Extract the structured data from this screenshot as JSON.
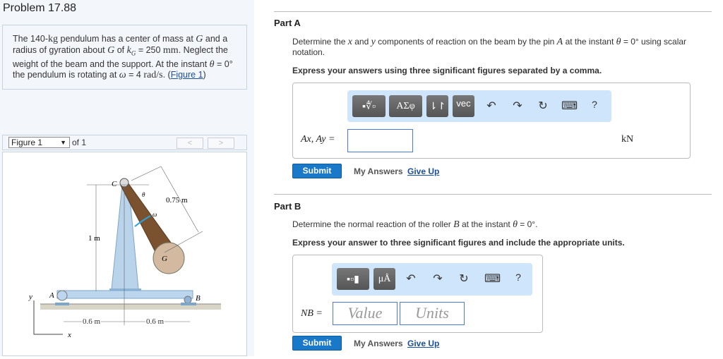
{
  "problem": {
    "title": "Problem 17.88",
    "text_parts": [
      "The 140-",
      "kg",
      " pendulum has a center of mass at ",
      "G",
      " and a radius of gyration about ",
      "G",
      " of ",
      "k",
      "G",
      " = 250 ",
      "mm",
      ". Neglect the weight of the beam and the support. At the instant ",
      "θ",
      " = 0° the pendulum is rotating at ",
      "ω",
      " = 4 ",
      "rad/s",
      ". (",
      ")"
    ],
    "figure_link": "Figure 1"
  },
  "figure_nav": {
    "selected": "Figure 1",
    "of": "of 1",
    "prev": "<",
    "next": ">"
  },
  "figure": {
    "labels": {
      "C": "C",
      "theta": "θ",
      "length_cg": "0.75 m",
      "omega": "ω",
      "height": "1 m",
      "G": "G",
      "A": "A",
      "B": "B",
      "y": "y",
      "x": "x",
      "dist_left": "0.6 m",
      "dist_right": "0.6 m"
    }
  },
  "partA": {
    "title": "Part A",
    "question_parts": [
      "Determine the ",
      "x",
      " and ",
      "y",
      " components of reaction on the beam by the pin ",
      "A",
      " at the instant ",
      "θ",
      " = 0° using scalar notation."
    ],
    "instruction": "Express your answers using three significant figures separated by a comma.",
    "toolbar": {
      "templates": "▪∜▫",
      "greek": "ΑΣφ",
      "arrows": "⇂↾",
      "vec": "vec",
      "undo": "↶",
      "redo": "↷",
      "reset": "↻",
      "keyboard": "⌨",
      "help": "?"
    },
    "label": "Ax, Ay =",
    "value": "",
    "unit": "kN",
    "submit": "Submit",
    "my_answers": "My Answers",
    "give_up": "Give Up"
  },
  "partB": {
    "title": "Part B",
    "question_parts": [
      "Determine the normal reaction of the roller ",
      "B",
      " at the instant ",
      "θ",
      " = 0°."
    ],
    "instruction": "Express your answer to three significant figures and include the appropriate units.",
    "toolbar": {
      "templates": "▪▫▮",
      "units": "μÅ",
      "undo": "↶",
      "redo": "↷",
      "reset": "↻",
      "keyboard": "⌨",
      "help": "?"
    },
    "label": "NB =",
    "value_placeholder": "Value",
    "units_placeholder": "Units",
    "submit": "Submit",
    "my_answers": "My Answers",
    "give_up": "Give Up"
  }
}
